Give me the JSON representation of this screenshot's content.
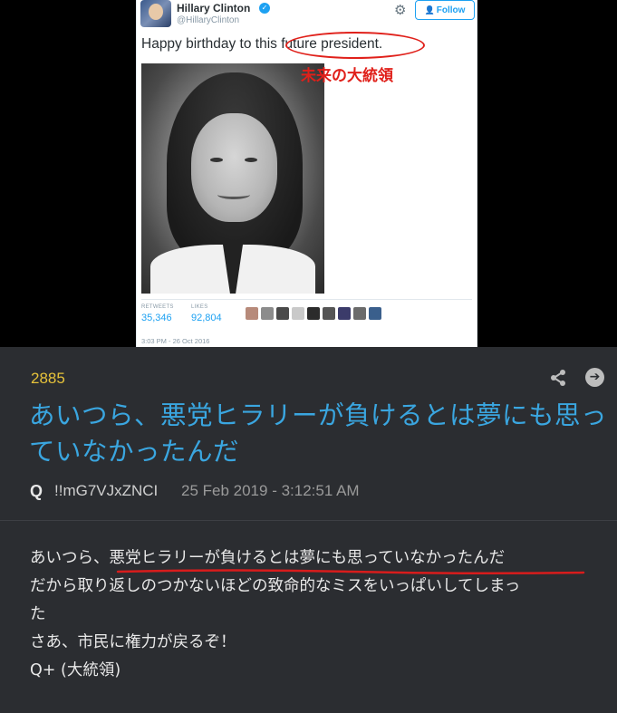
{
  "tweet": {
    "display_name": "Hillary Clinton",
    "handle": "@HillaryClinton",
    "follow_label": "Follow",
    "text": "Happy birthday to this future president.",
    "annotation_jp": "未来の大統領",
    "retweets_label": "RETWEETS",
    "retweets_value": "35,346",
    "likes_label": "LIKES",
    "likes_value": "92,804",
    "timestamp": "3:03 PM - 26 Oct 2016",
    "colors": {
      "link": "#1da1f2",
      "annotation": "#e0201a"
    }
  },
  "post": {
    "number": "2885",
    "title": "あいつら、悪党ヒラリーが負けるとは夢にも思っていなかったんだ",
    "author": "Q",
    "tripcode": "!!mG7VJxZNCI",
    "date": "25 Feb 2019 - 3:12:51 AM",
    "body_lines": [
      "あいつら、悪党ヒラリーが負けるとは夢にも思っていなかったんだ",
      "だから取り返しのつかないほどの致命的なミスをいっぱいしてしまっ",
      "た",
      "さあ、市民に権力が戻るぞ！",
      "Q+ (大統領)"
    ],
    "colors": {
      "number": "#e6c23a",
      "title": "#3aa6e0",
      "background": "#2b2d31"
    }
  }
}
